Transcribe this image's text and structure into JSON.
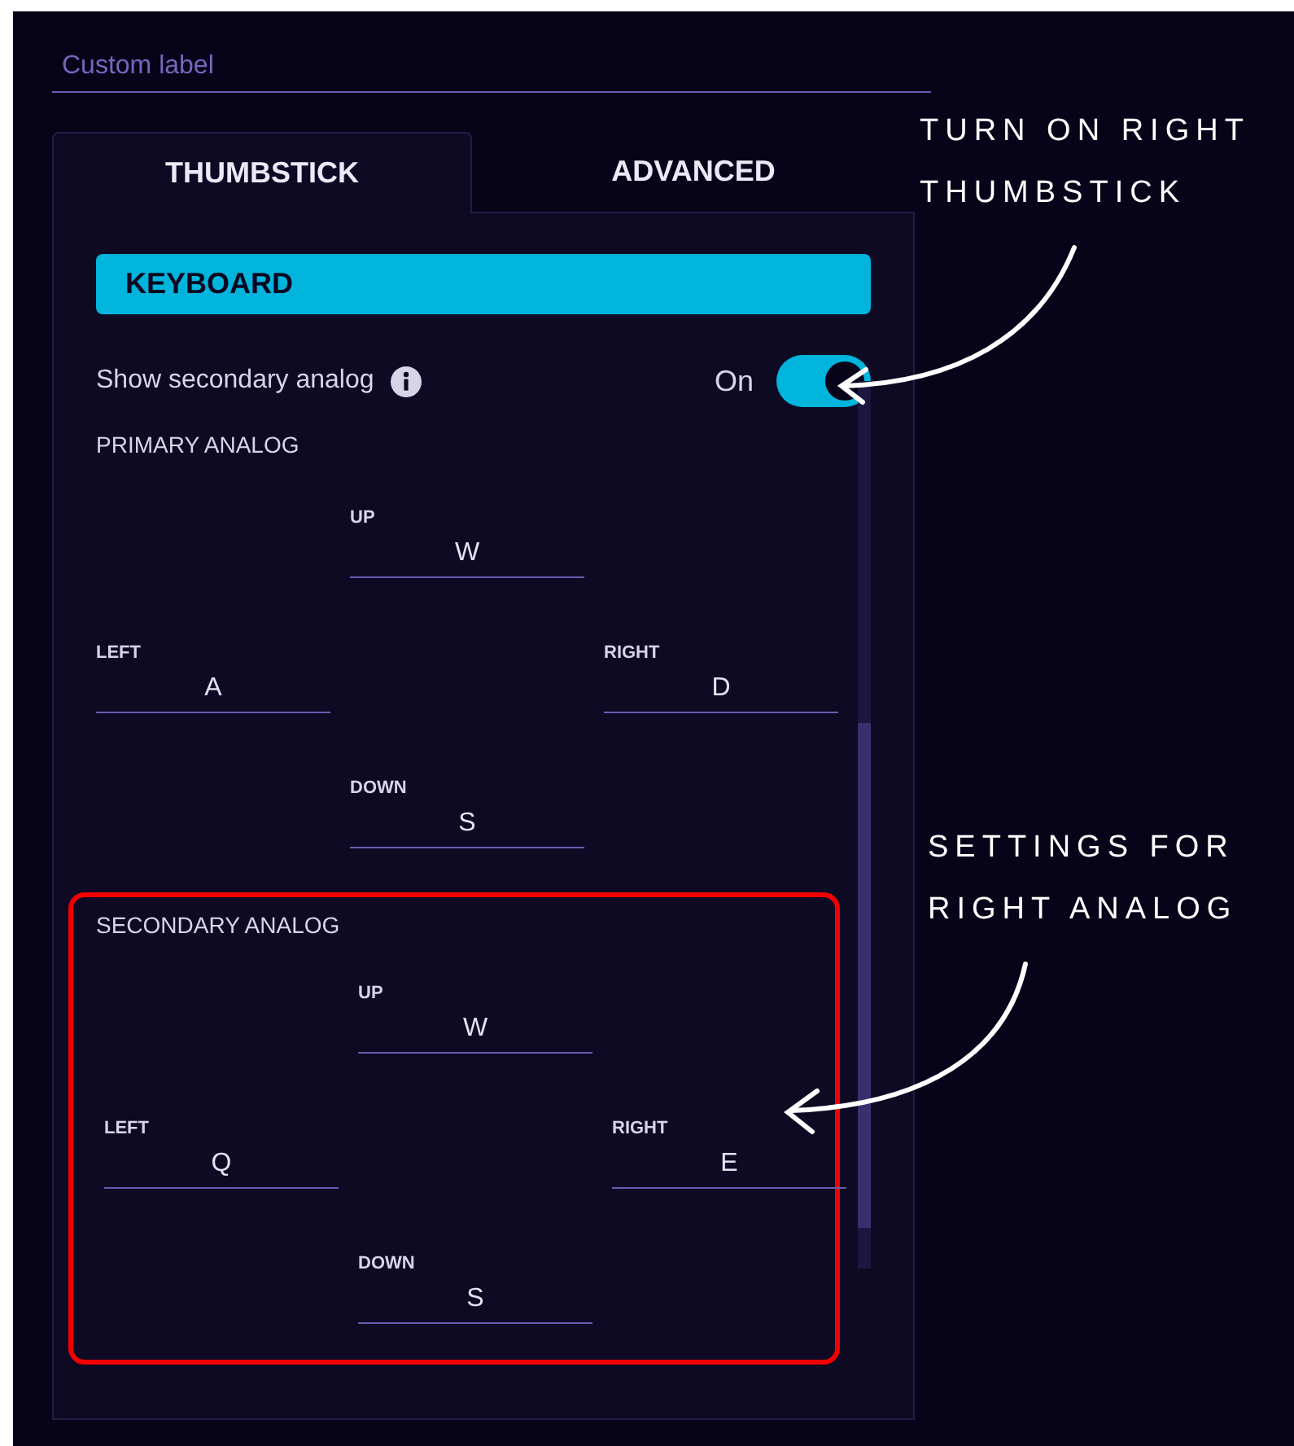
{
  "custom_label": {
    "placeholder": "Custom label"
  },
  "tabs": [
    {
      "label": "THUMBSTICK",
      "selected": true
    },
    {
      "label": "ADVANCED",
      "selected": false
    }
  ],
  "input_type": {
    "label": "KEYBOARD"
  },
  "secondary_toggle": {
    "label": "Show secondary analog",
    "state_text": "On",
    "on": true
  },
  "sections": [
    {
      "title": "PRIMARY ANALOG",
      "highlighted": false,
      "bindings": [
        {
          "kind": "up",
          "label": "UP",
          "key": "W"
        },
        {
          "kind": "left",
          "label": "LEFT",
          "key": "A"
        },
        {
          "kind": "right",
          "label": "RIGHT",
          "key": "D"
        },
        {
          "kind": "down",
          "label": "DOWN",
          "key": "S"
        }
      ]
    },
    {
      "title": "SECONDARY ANALOG",
      "highlighted": true,
      "bindings": [
        {
          "kind": "up",
          "label": "UP",
          "key": "W"
        },
        {
          "kind": "left",
          "label": "LEFT",
          "key": "Q"
        },
        {
          "kind": "right",
          "label": "RIGHT",
          "key": "E"
        },
        {
          "kind": "down",
          "label": "DOWN",
          "key": "S"
        }
      ]
    }
  ],
  "annotations": [
    {
      "lines": [
        "TURN ON RIGHT",
        "THUMBSTICK"
      ]
    },
    {
      "lines": [
        "SETTINGS FOR",
        "RIGHT ANALOG"
      ]
    }
  ]
}
